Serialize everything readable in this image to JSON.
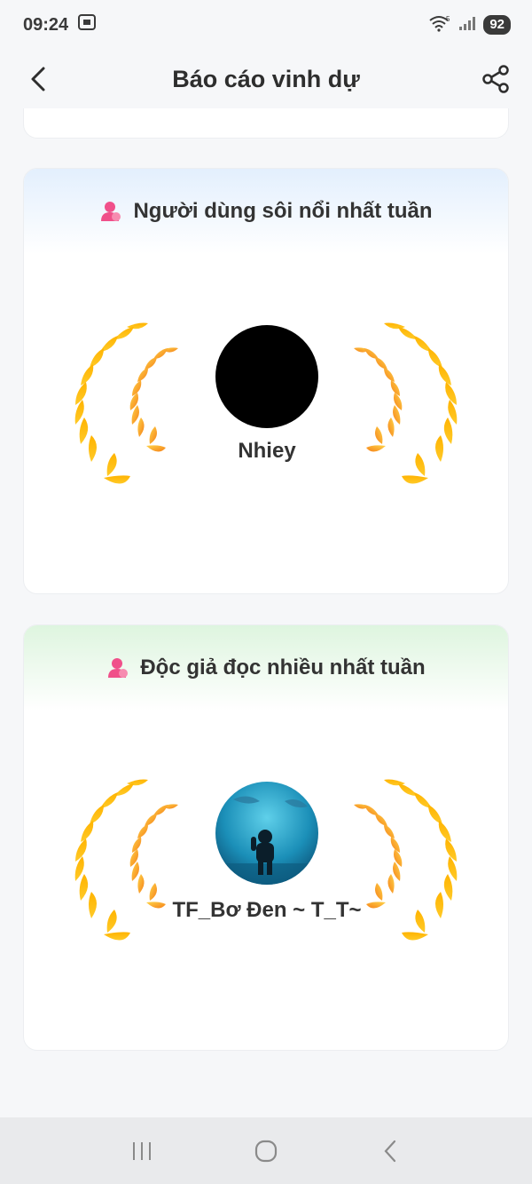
{
  "status_bar": {
    "time": "09:24",
    "battery": "92",
    "icons": [
      "screenshot-icon",
      "wifi-icon",
      "signal-icon"
    ]
  },
  "header": {
    "title": "Báo cáo vinh dự",
    "back_icon": "chevron-left-icon",
    "share_icon": "share-icon"
  },
  "cards": [
    {
      "title": "Người dùng sôi nổi nhất tuần",
      "icon": "user-icon",
      "accent": "#e3effd",
      "user": {
        "name": "Nhiey",
        "avatar": "black-circle"
      }
    },
    {
      "title": "Độc giả đọc nhiều nhất tuần",
      "icon": "user-icon",
      "accent": "#def5df",
      "user": {
        "name": "TF_Bơ Đen ~ T_T~",
        "avatar": "aquarium-photo"
      }
    }
  ],
  "nav_bar": {
    "icons": [
      "recent-apps-icon",
      "home-icon",
      "back-icon"
    ]
  },
  "colors": {
    "laurel_light": "#ffc21a",
    "laurel_dark": "#f57f17",
    "user_icon": "#f0508a"
  }
}
